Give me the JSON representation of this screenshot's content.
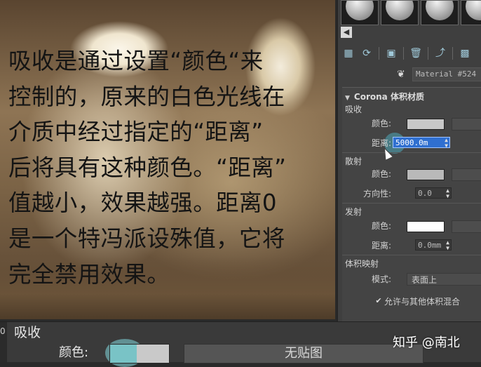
{
  "caption": {
    "lines": [
      "吸收是通过设置“颜色“来",
      "控制的，原来的白色光线在",
      "介质中经过指定的“距离”",
      "后将具有这种颜色。“距离”",
      "值越小，效果越强。距离0",
      "是一个特冯派设殊值，它将",
      "完全禁用效果。"
    ]
  },
  "panel": {
    "material_name": "Material #524",
    "rollout_title": "Corona 体积材质",
    "absorption": {
      "group": "吸收",
      "color_label": "颜色:",
      "color_value": "#c8c8c8",
      "distance_label": "距离:",
      "distance_value": "5000.0m"
    },
    "scattering": {
      "group": "散射",
      "color_label": "颜色:",
      "color_value": "#b9b9b9",
      "direction_label": "方向性:",
      "direction_value": "0.0"
    },
    "emission": {
      "group": "发射",
      "color_label": "颜色:",
      "color_value": "#ffffff",
      "distance_label": "距离:",
      "distance_value": "0.0mm"
    },
    "volume_mapping": {
      "group": "体积映射",
      "mode_label": "模式:",
      "mode_value": "表面上",
      "mix_checkbox_label": "允许与其他体积混合",
      "mix_checked": true
    }
  },
  "bottom": {
    "index_label": "0",
    "title": "吸收",
    "color_label": "颜色:",
    "no_map_label": "无贴图"
  },
  "watermark": "知乎 @南北",
  "icons": {
    "nav_left": "chevron-left-icon",
    "eyedropper": "eyedropper-icon",
    "checkbox": "checkmark-icon"
  }
}
